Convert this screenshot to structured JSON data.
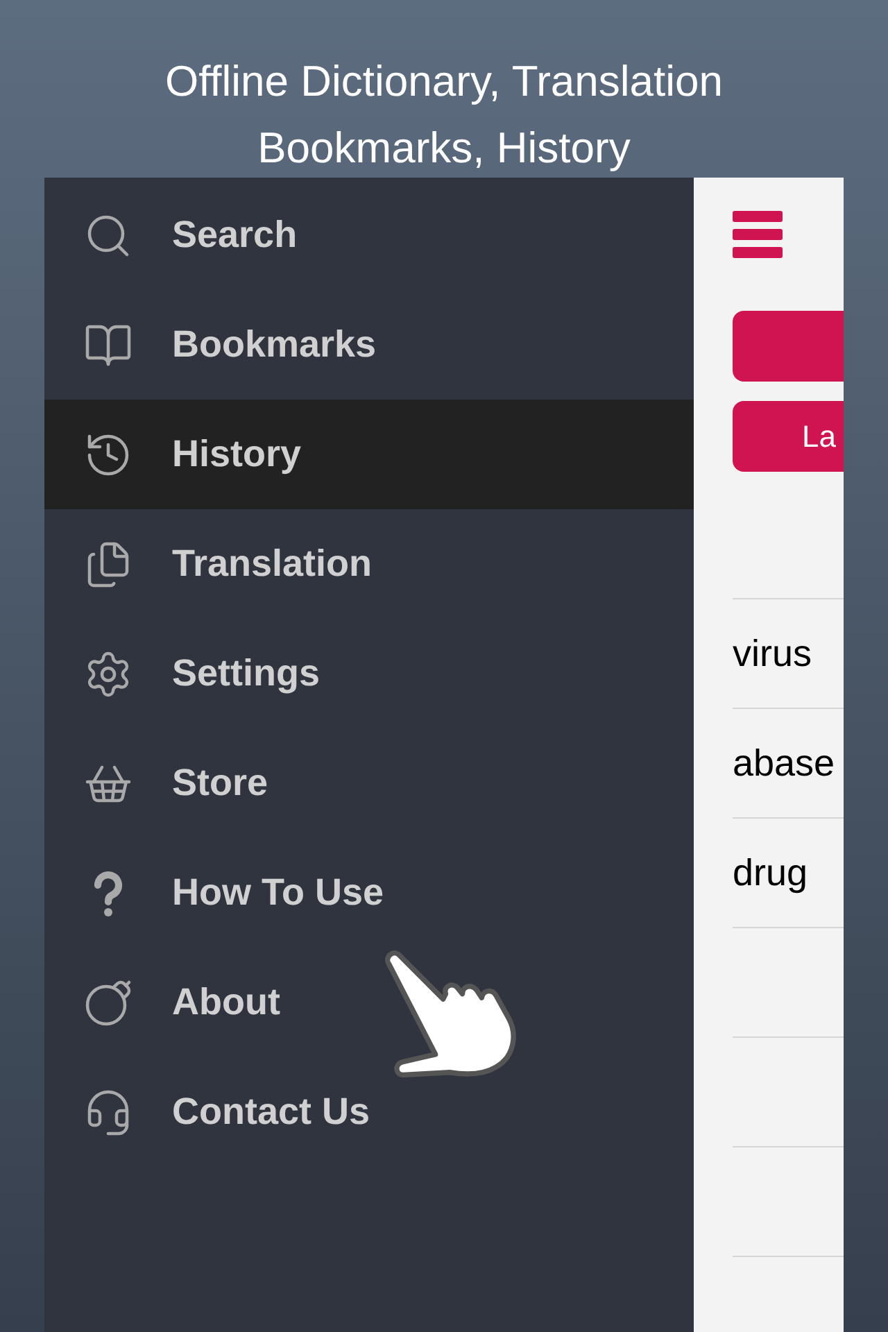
{
  "headline": [
    "Offline Dictionary, Translation",
    "Bookmarks, History"
  ],
  "menu": [
    {
      "label": "Search",
      "selected": false
    },
    {
      "label": "Bookmarks",
      "selected": false
    },
    {
      "label": "History",
      "selected": true
    },
    {
      "label": "Translation",
      "selected": false
    },
    {
      "label": "Settings",
      "selected": false
    },
    {
      "label": "Store",
      "selected": false
    },
    {
      "label": "How To Use",
      "selected": false
    },
    {
      "label": "About",
      "selected": false
    },
    {
      "label": "Contact Us",
      "selected": false
    }
  ],
  "content": {
    "buttons": [
      {
        "kind": "blank"
      },
      {
        "kind": "text",
        "label": "La"
      }
    ],
    "words": [
      "virus",
      "abase",
      "drug"
    ]
  }
}
